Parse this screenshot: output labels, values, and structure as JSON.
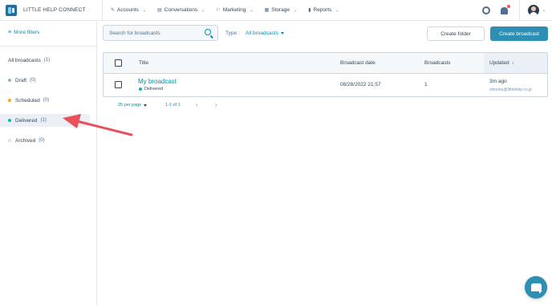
{
  "app": {
    "brand": "LITTLE HELP CONNECT"
  },
  "nav": {
    "items": [
      {
        "label": "Accounts",
        "icon": "wrench-icon",
        "icon_glyph": "✎"
      },
      {
        "label": "Conversations",
        "icon": "chat-icon",
        "icon_glyph": "▤"
      },
      {
        "label": "Marketing",
        "icon": "megaphone-icon",
        "icon_glyph": "⚐"
      },
      {
        "label": "Storage",
        "icon": "folder-icon",
        "icon_glyph": "▦"
      },
      {
        "label": "Reports",
        "icon": "chart-icon",
        "icon_glyph": "▮"
      }
    ],
    "notification_color": "#f2545b"
  },
  "sidebar": {
    "more_filters": "More filters",
    "items": [
      {
        "label": "All broadcasts",
        "count": "(1)",
        "dot_color": ""
      },
      {
        "label": "Draft",
        "count": "(0)",
        "dot_color": "#99afc4"
      },
      {
        "label": "Scheduled",
        "count": "(0)",
        "dot_color": "#f5a623"
      },
      {
        "label": "Delivered",
        "count": "(1)",
        "dot_color": "#00bda5"
      },
      {
        "label": "Archived",
        "count": "(0)",
        "dot_color": "#dfe3eb"
      }
    ],
    "active_index": 3
  },
  "toolbar": {
    "search_placeholder": "Search for broadcasts",
    "type_label": "Type :",
    "type_value": "All broadcasts",
    "create_folder": "Create folder",
    "create_broadcast": "Create broadcast"
  },
  "table": {
    "headers": {
      "title": "Title",
      "date": "Broadcast date",
      "broadcasts": "Broadcasts",
      "updated": "Updated"
    },
    "rows": [
      {
        "title": "My broadcast",
        "status": "Delivered",
        "date": "08/28/2022 21:57",
        "broadcasts": "1",
        "updated": "3m ago",
        "updated_by": "shinobu@littlehelp.co.jp"
      }
    ]
  },
  "pagination": {
    "per_page": "25 per page",
    "range": "1-1 of 1"
  },
  "colors": {
    "accent": "#0091ae",
    "primary_button": "#2e8fb4",
    "annotation_arrow": "#e8505b"
  }
}
